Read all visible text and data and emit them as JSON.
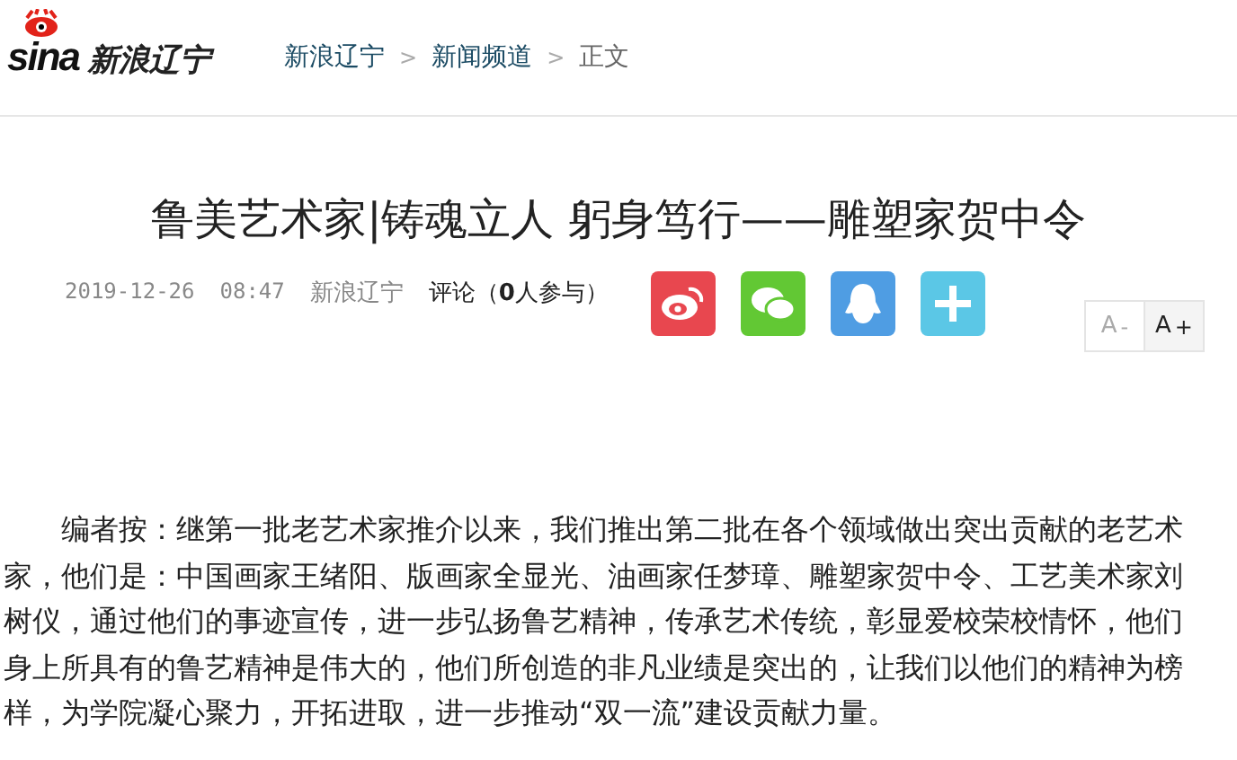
{
  "header": {
    "logo": {
      "wordmark": "sina",
      "site": "新浪辽宁"
    },
    "breadcrumb": [
      {
        "label": "新浪辽宁",
        "link": true
      },
      {
        "label": "新闻频道",
        "link": true
      },
      {
        "label": "正文",
        "link": false
      }
    ],
    "separator": ">"
  },
  "article": {
    "title": "鲁美艺术家|铸魂立人 躬身笃行——雕塑家贺中令",
    "date": "2019-12-26",
    "time": "08:47",
    "source": "新浪辽宁",
    "comments": "评论（**0**人参与）",
    "share": [
      {
        "kind": "weibo",
        "color": "#e8474f"
      },
      {
        "kind": "wechat",
        "color": "#62c834"
      },
      {
        "kind": "qq",
        "color": "#4f9de3"
      },
      {
        "kind": "more",
        "color": "#5bc7e6"
      }
    ],
    "font_size": [
      {
        "label": "A",
        "sign": "-",
        "selected": false
      },
      {
        "label": "A",
        "sign": "+",
        "selected": true
      }
    ],
    "body": "编者按：继第一批老艺术家推介以来，我们推出第二批在各个领域做出突出贡献的老艺术家，他们是：中国画家王绪阳、版画家全显光、油画家任梦璋、雕塑家贺中令、工艺美术家刘树仪，通过他们的事迹宣传，进一步弘扬鲁艺精神，传承艺术传统，彰显爱校荣校情怀，他们身上所具有的鲁艺精神是伟大的，他们所创造的非凡业绩是突出的，让我们以他们的精神为榜样，为学院凝心聚力，开拓进取，进一步推动“双一流”建设贡献力量。"
  }
}
